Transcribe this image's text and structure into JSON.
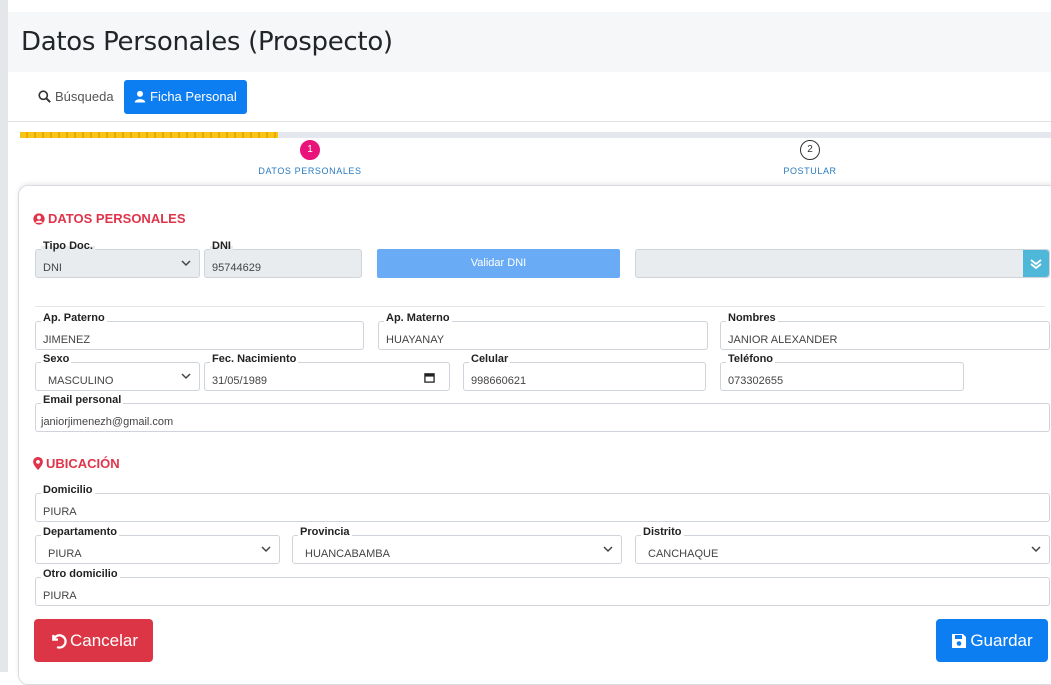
{
  "page": {
    "title": "Datos Personales (Prospecto)"
  },
  "tabs": {
    "search_label": "Búsqueda",
    "ficha_label": "Ficha Personal"
  },
  "stepper": {
    "progress": 0.25,
    "steps": [
      {
        "number": "1",
        "label": "DATOS PERSONALES",
        "state": "active"
      },
      {
        "number": "2",
        "label": "POSTULAR",
        "state": "pending"
      }
    ]
  },
  "personal": {
    "section_title": "DATOS PERSONALES",
    "tipo_doc": {
      "label": "Tipo Doc.",
      "value": "DNI"
    },
    "dni": {
      "label": "DNI",
      "value": "95744629"
    },
    "validate_label": "Validar DNI",
    "ap_paterno": {
      "label": "Ap. Paterno",
      "value": "JIMENEZ"
    },
    "ap_materno": {
      "label": "Ap. Materno",
      "value": "HUAYANAY"
    },
    "nombres": {
      "label": "Nombres",
      "value": "JANIOR ALEXANDER"
    },
    "sexo": {
      "label": "Sexo",
      "value": "MASCULINO"
    },
    "fec_nacimiento": {
      "label": "Fec. Nacimiento",
      "value": "31/05/1989"
    },
    "celular": {
      "label": "Celular",
      "value": "998660621"
    },
    "telefono": {
      "label": "Teléfono",
      "value": "073302655"
    },
    "email": {
      "label": "Email personal",
      "value": "janiorjimenezh@gmail.com"
    }
  },
  "ubicacion": {
    "section_title": "UBICACIÓN",
    "domicilio": {
      "label": "Domicilio",
      "value": "PIURA"
    },
    "departamento": {
      "label": "Departamento",
      "value": "PIURA"
    },
    "provincia": {
      "label": "Provincia",
      "value": "HUANCABAMBA"
    },
    "distrito": {
      "label": "Distrito",
      "value": "CANCHAQUE"
    },
    "otro_domicilio": {
      "label": "Otro domicilio",
      "value": "PIURA"
    }
  },
  "actions": {
    "cancel_label": "Cancelar",
    "save_label": "Guardar"
  },
  "colors": {
    "primary": "#0d7ef2",
    "danger": "#dc3545",
    "section_red": "#e0344a",
    "step_active": "#e8147a",
    "progress": "#f5c518"
  },
  "icons": [
    "search-icon",
    "user-icon",
    "user-circle-icon",
    "map-marker-icon",
    "chevron-down-icon",
    "calendar-icon",
    "double-check-icon",
    "undo-icon",
    "save-icon"
  ]
}
